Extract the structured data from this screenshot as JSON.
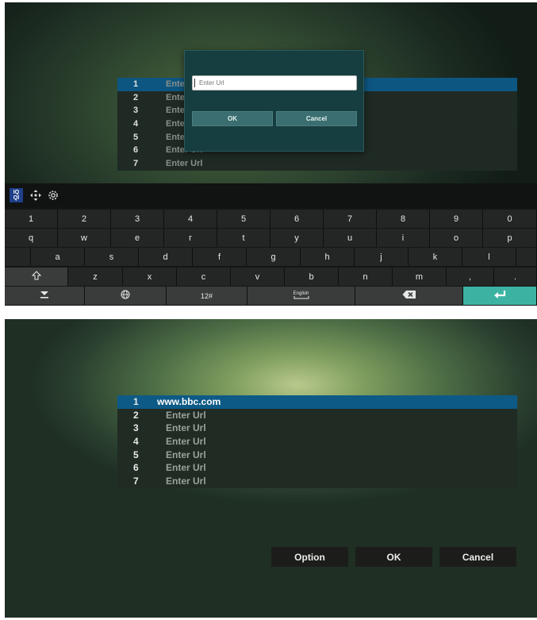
{
  "panel1": {
    "list_numbers": [
      "1",
      "2",
      "3",
      "4",
      "5",
      "6",
      "7"
    ],
    "list_text": [
      "Ente",
      "Ente",
      "Ente",
      "Ente",
      "Ente",
      "Enter Url",
      "Enter Url"
    ],
    "dialog": {
      "placeholder": "Enter Url",
      "ok_label": "OK",
      "cancel_label": "Cancel"
    },
    "keyboard": {
      "tool_logo_top": "IQ",
      "tool_logo_bottom": "QI",
      "number_row": [
        "1",
        "2",
        "3",
        "4",
        "5",
        "6",
        "7",
        "8",
        "9",
        "0"
      ],
      "row_q": [
        "q",
        "w",
        "e",
        "r",
        "t",
        "y",
        "u",
        "i",
        "o",
        "p"
      ],
      "row_a": [
        "a",
        "s",
        "d",
        "f",
        "g",
        "h",
        "j",
        "k",
        "l"
      ],
      "row_z": [
        "z",
        "x",
        "c",
        "v",
        "b",
        "n",
        "m",
        ",",
        "."
      ],
      "symbols_label": "12#",
      "language_label": "English"
    }
  },
  "panel2": {
    "urls": [
      {
        "num": "1",
        "text": "www.bbc.com"
      },
      {
        "num": "2",
        "text": "Enter Url"
      },
      {
        "num": "3",
        "text": "Enter Url"
      },
      {
        "num": "4",
        "text": "Enter Url"
      },
      {
        "num": "5",
        "text": "Enter Url"
      },
      {
        "num": "6",
        "text": "Enter Url"
      },
      {
        "num": "7",
        "text": "Enter Url"
      }
    ],
    "option_label": "Option",
    "ok_label": "OK",
    "cancel_label": "Cancel"
  },
  "colors": {
    "selected_row": "#0d5681",
    "dialog_bg": "#163d3f",
    "enter_key": "#3cb3a2"
  }
}
